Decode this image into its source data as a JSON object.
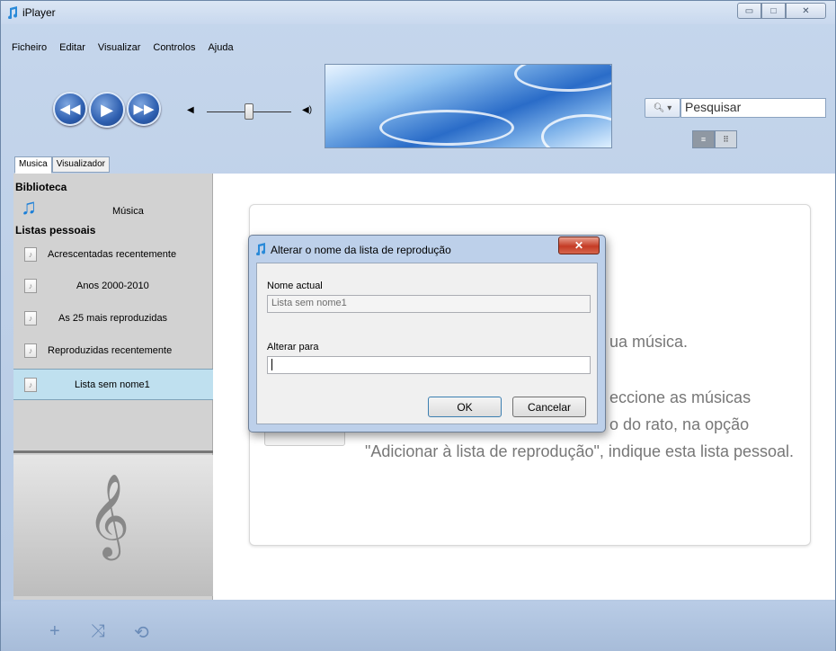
{
  "window": {
    "title": "iPlayer",
    "icon": "music-note-icon",
    "controls": [
      "minimize",
      "maximize",
      "close"
    ]
  },
  "menu": [
    "Ficheiro",
    "Editar",
    "Visualizar",
    "Controlos",
    "Ajuda"
  ],
  "transport": {
    "prev_icon": "rewind-icon",
    "play_icon": "play-icon",
    "next_icon": "fast-forward-icon"
  },
  "volume": {
    "level": 0.5
  },
  "search": {
    "placeholder": "Pesquisar"
  },
  "tabs": [
    "Musica",
    "Visualizador"
  ],
  "sidebar": {
    "library_header": "Biblioteca",
    "library_item": "Música",
    "playlists_header": "Listas pessoais",
    "playlists": [
      "Acrescentadas recentemente",
      "Anos 2000-2010",
      "As 25 mais reproduzidas",
      "Reproduzidas recentemente",
      "Lista sem nome1"
    ],
    "selected": "Lista sem nome1"
  },
  "main": {
    "line1": "ua música.",
    "line2": "eccione as músicas",
    "line3": "o do rato, na opção",
    "line4": "\"Adicionar à lista de reprodução\", indique esta lista pessoal."
  },
  "dialog": {
    "title": "Alterar o nome da lista de reprodução",
    "current_label": "Nome actual",
    "current_value": "Lista sem nome1",
    "new_label": "Alterar para",
    "new_value": "",
    "ok": "OK",
    "cancel": "Cancelar"
  },
  "colors": {
    "accent": "#2e5fb0",
    "selection": "#bfe0ef",
    "close_red": "#c53b25"
  }
}
